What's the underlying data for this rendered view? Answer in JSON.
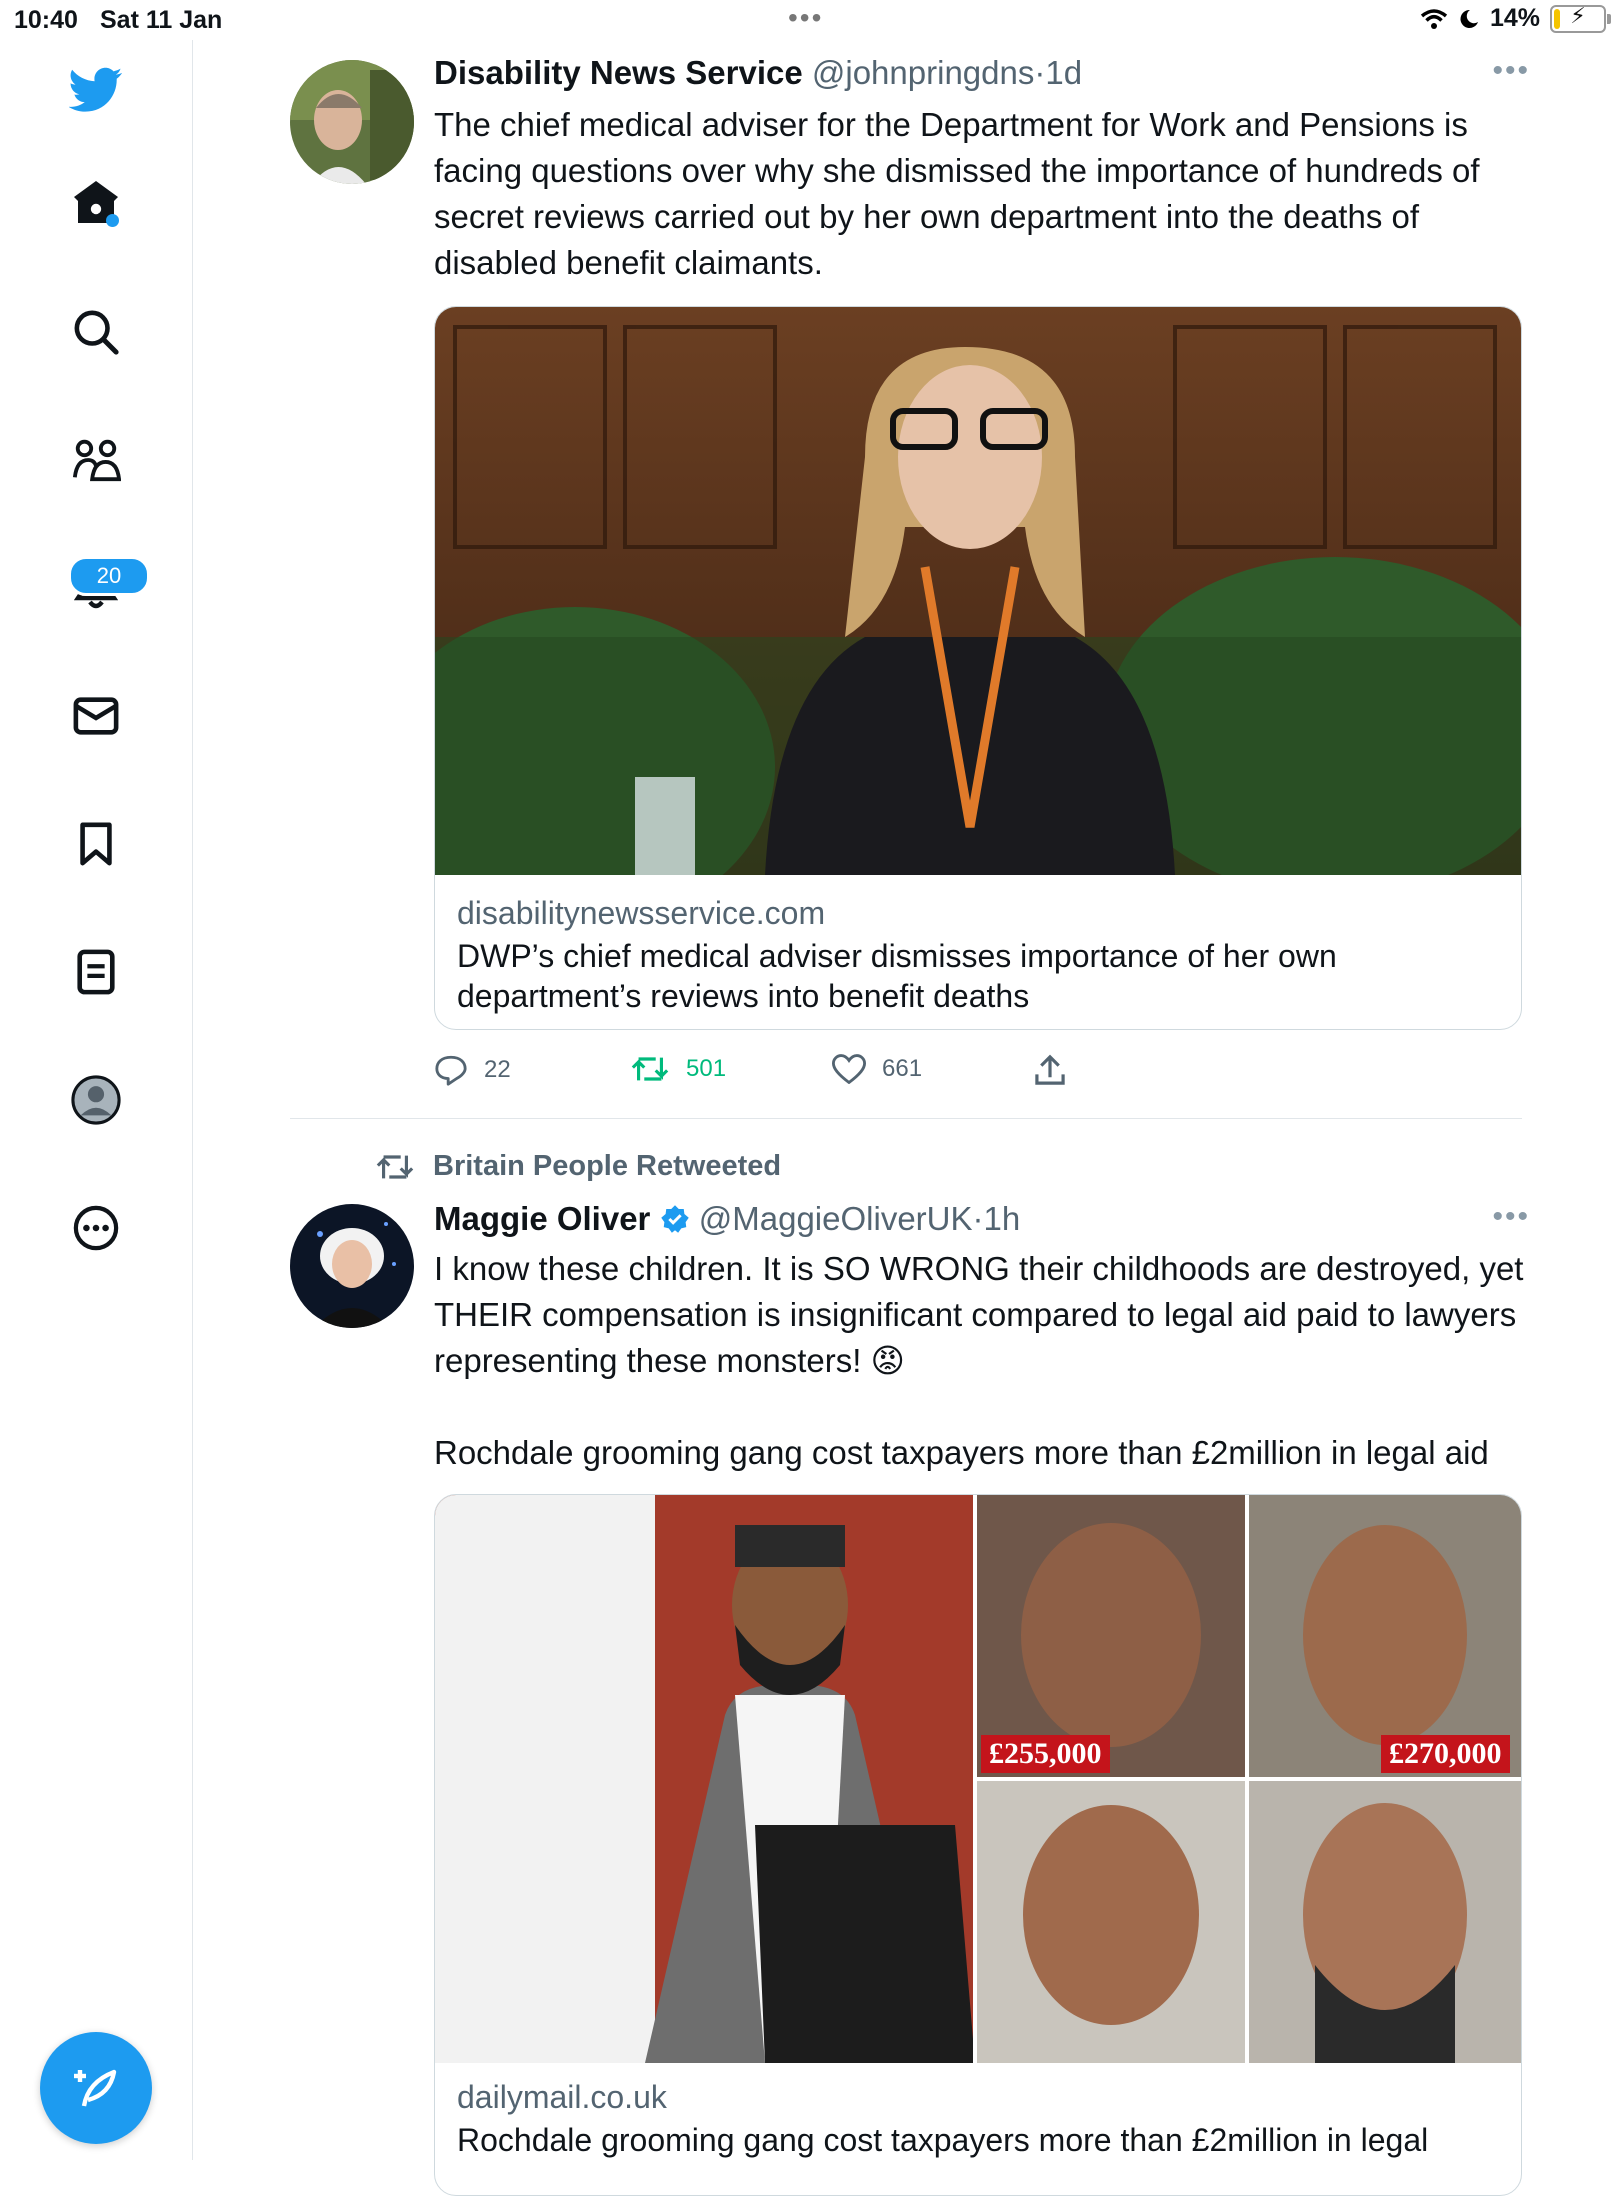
{
  "status_bar": {
    "time": "10:40",
    "date": "Sat 11 Jan",
    "battery": "14%",
    "battery_level": 0.14
  },
  "sidebar": {
    "notifications_badge": "20",
    "icons": [
      "twitter-bird-icon",
      "home-icon",
      "search-icon",
      "communities-icon",
      "notifications-icon",
      "messages-icon",
      "bookmarks-icon",
      "lists-icon",
      "profile-icon",
      "more-icon"
    ]
  },
  "tweets": [
    {
      "name": "Disability News Service",
      "handle": "@johnpringdns",
      "sep": "·",
      "time": "1d",
      "text": "The chief medical adviser for the Department for Work and Pensions is facing questions over why she dismissed the importance of hundreds of secret reviews carried out by her own department into the deaths of disabled benefit claimants.",
      "card": {
        "domain": "disabilitynewsservice.com",
        "title": "DWP’s chief medical adviser dismisses importance of her own department’s reviews into benefit deaths"
      },
      "stats": {
        "replies": "22",
        "retweets": "501",
        "likes": "661"
      }
    },
    {
      "retweeted_by": "Britain People Retweeted",
      "name": "Maggie Oliver",
      "handle": "@MaggieOliverUK",
      "sep": "·",
      "time": "1h",
      "text": "I know these children. It is SO WRONG their childhoods are destroyed, yet THEIR compensation is insignificant compared to legal aid paid to lawyers representing these monsters! 😡",
      "text2": "Rochdale grooming gang cost taxpayers more than £2million in legal aid",
      "card": {
        "domain": "dailymail.co.uk",
        "title": "Rochdale grooming gang cost taxpayers more than £2million in legal",
        "tags": [
          "£255,000",
          "£270,000"
        ]
      }
    }
  ],
  "colors": {
    "accent": "#1d9bf0",
    "retweet_green": "#00ba7c",
    "muted": "#536471"
  }
}
